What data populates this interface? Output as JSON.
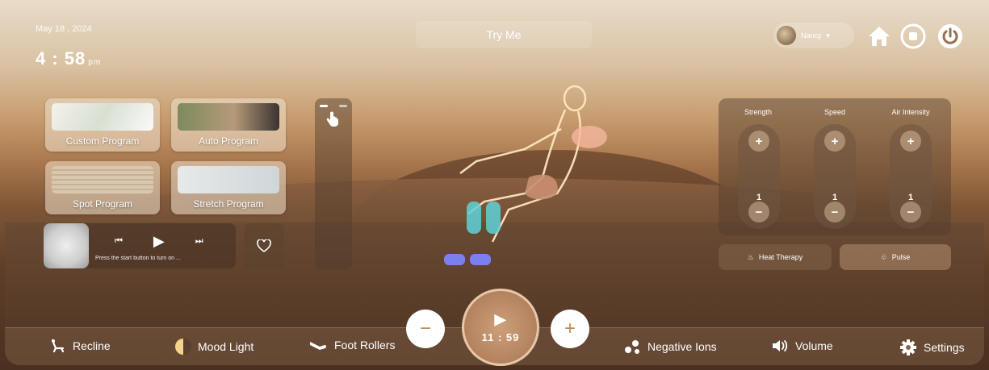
{
  "header": {
    "date": "May 18 , 2024",
    "time": "4 : 58",
    "ampm": "pm",
    "title": "Try Me",
    "user_name": "Nancy",
    "icons": [
      "home-icon",
      "stop-icon",
      "power-icon"
    ]
  },
  "programs": [
    {
      "label": "Custom Program"
    },
    {
      "label": "Auto Program"
    },
    {
      "label": "Spot Program"
    },
    {
      "label": "Stretch Program"
    }
  ],
  "music": {
    "status_text": "Press the start button to turn on ..."
  },
  "controls": {
    "columns": [
      {
        "label": "Strength",
        "value": "1"
      },
      {
        "label": "Speed",
        "value": "1"
      },
      {
        "label": "Air Intensity",
        "value": "1"
      }
    ],
    "heat_label": "Heat Therapy",
    "pulse_label": "Pulse"
  },
  "timer": {
    "value": "11 : 59",
    "minus": "−",
    "plus": "+"
  },
  "bottom_bar": {
    "recline": "Recline",
    "mood_light": "Mood Light",
    "foot_rollers": "Foot Rollers",
    "negative_ions": "Negative Ions",
    "volume": "Volume",
    "settings": "Settings"
  }
}
